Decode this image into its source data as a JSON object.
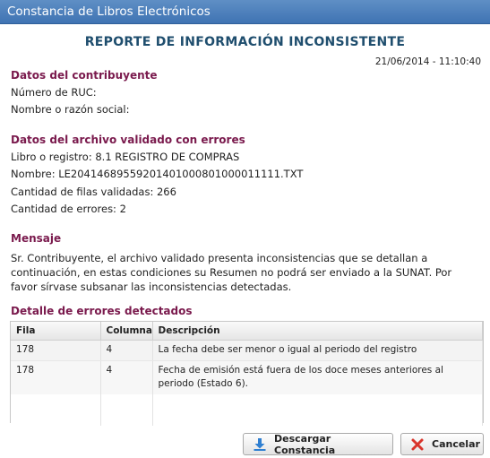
{
  "window": {
    "title": "Constancia de Libros Electrónicos"
  },
  "report": {
    "title": "REPORTE DE INFORMACIÓN INCONSISTENTE",
    "timestamp": "21/06/2014 - 11:10:40"
  },
  "taxpayer": {
    "section_title": "Datos del contribuyente",
    "ruc_label": "Número de RUC:",
    "name_label": "Nombre o razón social:"
  },
  "file": {
    "section_title": "Datos del archivo validado con errores",
    "book_line": "Libro o registro: 8.1 REGISTRO DE COMPRAS",
    "name_line": "Nombre: LE20414689559201401000801000011111.TXT",
    "rows_line": "Cantidad de filas validadas: 266",
    "errors_line": "Cantidad de errores: 2"
  },
  "message": {
    "section_title": "Mensaje",
    "text": "Sr. Contribuyente, el archivo validado presenta inconsistencias que se detallan a continuación, en estas condiciones su Resumen no podrá ser enviado a la SUNAT. Por favor sírvase subsanar las inconsistencias detectadas."
  },
  "errors": {
    "section_title": "Detalle de errores detectados",
    "columns": [
      "Fila",
      "Columna",
      "Descripción"
    ],
    "rows": [
      {
        "fila": "178",
        "columna": "4",
        "descripcion": "La fecha debe ser menor o igual al periodo del registro"
      },
      {
        "fila": "178",
        "columna": "4",
        "descripcion": "Fecha de emisión está fuera de los doce meses anteriores al periodo (Estado 6)."
      }
    ]
  },
  "buttons": {
    "download_label": "Descargar Constancia",
    "cancel_label": "Cancelar"
  },
  "icons": {
    "download": "download-icon",
    "cancel": "cancel-icon"
  },
  "colors": {
    "titlebar": "#4a7fbd",
    "section_title": "#7a1a4d",
    "report_title": "#1f4e6e",
    "download_icon": "#2f7fd1",
    "cancel_icon": "#d9342b"
  }
}
